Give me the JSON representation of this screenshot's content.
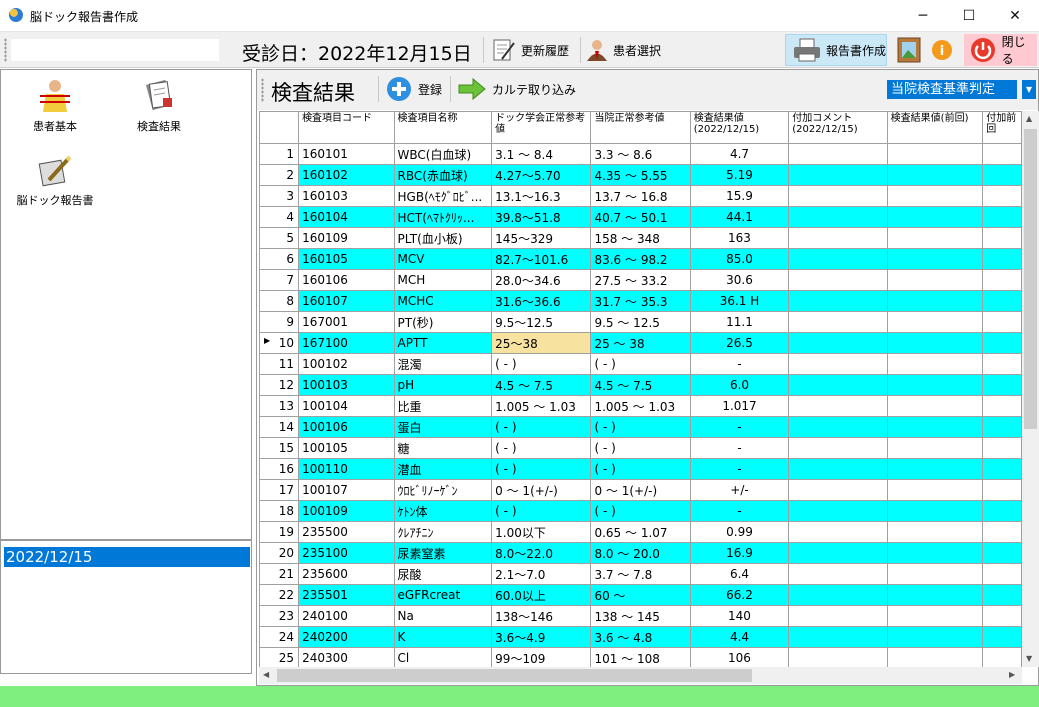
{
  "window": {
    "title": "脳ドック報告書作成",
    "minimize": "─",
    "maximize": "☐",
    "close": "✕"
  },
  "toolbar": {
    "visit_date": "受診日：2022年12月15日",
    "history_label": "更新履歴",
    "patient_select_label": "患者選択",
    "report_create_label": "報告書作成",
    "close_label": "閉じる"
  },
  "nav": {
    "patient_basic": "患者基本",
    "test_results": "検査結果",
    "brain_dock_report": "脳ドック報告書"
  },
  "dates": [
    "2022/12/15"
  ],
  "results": {
    "section_title": "検査結果",
    "register_label": "登録",
    "import_label": "カルテ取り込み",
    "judgement_select": "当院検査基準判定",
    "columns": [
      "検査項目コード",
      "検査項目名称",
      "ドック学会正常参考値",
      "当院正常参考値",
      "検査結果値(2022/12/15)",
      "付加コメント(2022/12/15)",
      "検査結果値(前回)",
      "付加前回"
    ],
    "selected_row": 10,
    "rows": [
      {
        "no": "1",
        "code": "160101",
        "name": "WBC(白血球)",
        "dock": "3.1 ～ 8.4",
        "hosp": "3.3 ～ 8.6",
        "value": "4.7"
      },
      {
        "no": "2",
        "code": "160102",
        "name": "RBC(赤血球)",
        "dock": "4.27～5.70",
        "hosp": "4.35 ～ 5.55",
        "value": "5.19"
      },
      {
        "no": "3",
        "code": "160103",
        "name": "HGB(ﾍﾓｸﾞﾛﾋﾞ...",
        "dock": "13.1～16.3",
        "hosp": "13.7 ～ 16.8",
        "value": "15.9"
      },
      {
        "no": "4",
        "code": "160104",
        "name": "HCT(ﾍﾏﾄｸﾘｯ...",
        "dock": "39.8～51.8",
        "hosp": "40.7 ～ 50.1",
        "value": "44.1"
      },
      {
        "no": "5",
        "code": "160109",
        "name": "PLT(血小板)",
        "dock": "145～329",
        "hosp": "158 ～ 348",
        "value": "163"
      },
      {
        "no": "6",
        "code": "160105",
        "name": "MCV",
        "dock": "82.7～101.6",
        "hosp": "83.6 ～ 98.2",
        "value": "85.0"
      },
      {
        "no": "7",
        "code": "160106",
        "name": "MCH",
        "dock": "28.0～34.6",
        "hosp": "27.5 ～ 33.2",
        "value": "30.6"
      },
      {
        "no": "8",
        "code": "160107",
        "name": "MCHC",
        "dock": "31.6～36.6",
        "hosp": "31.7 ～ 35.3",
        "value": "36.1  H"
      },
      {
        "no": "9",
        "code": "167001",
        "name": "PT(秒)",
        "dock": "9.5～12.5",
        "hosp": "9.5 ～ 12.5",
        "value": "11.1"
      },
      {
        "no": "10",
        "code": "167100",
        "name": "APTT",
        "dock": "25～38",
        "hosp": "25 ～ 38",
        "value": "26.5"
      },
      {
        "no": "11",
        "code": "100102",
        "name": "混濁",
        "dock": "( - )",
        "hosp": "( - )",
        "value": "-"
      },
      {
        "no": "12",
        "code": "100103",
        "name": "pH",
        "dock": "4.5 ～ 7.5",
        "hosp": "4.5 ～ 7.5",
        "value": "6.0"
      },
      {
        "no": "13",
        "code": "100104",
        "name": "比重",
        "dock": "1.005 ～ 1.03",
        "hosp": "1.005 ～ 1.03",
        "value": "1.017"
      },
      {
        "no": "14",
        "code": "100106",
        "name": "蛋白",
        "dock": "( - )",
        "hosp": "( - )",
        "value": "-"
      },
      {
        "no": "15",
        "code": "100105",
        "name": "糖",
        "dock": "( - )",
        "hosp": "( - )",
        "value": "-"
      },
      {
        "no": "16",
        "code": "100110",
        "name": "潜血",
        "dock": "( - )",
        "hosp": "( - )",
        "value": "-"
      },
      {
        "no": "17",
        "code": "100107",
        "name": "ｳﾛﾋﾞﾘﾉｰｹﾞﾝ",
        "dock": "0 ～ 1(+/-)",
        "hosp": "0 ～ 1(+/-)",
        "value": "+/-"
      },
      {
        "no": "18",
        "code": "100109",
        "name": "ｹﾄﾝ体",
        "dock": "( - )",
        "hosp": "( - )",
        "value": "-"
      },
      {
        "no": "19",
        "code": "235500",
        "name": "ｸﾚｱﾁﾆﾝ",
        "dock": "1.00以下",
        "hosp": "0.65 ～ 1.07",
        "value": "0.99"
      },
      {
        "no": "20",
        "code": "235100",
        "name": "尿素窒素",
        "dock": "8.0～22.0",
        "hosp": "8.0 ～ 20.0",
        "value": "16.9"
      },
      {
        "no": "21",
        "code": "235600",
        "name": "尿酸",
        "dock": "2.1～7.0",
        "hosp": "3.7 ～ 7.8",
        "value": "6.4"
      },
      {
        "no": "22",
        "code": "235501",
        "name": "eGFRcreat",
        "dock": "60.0以上",
        "hosp": "60 ～",
        "value": "66.2"
      },
      {
        "no": "23",
        "code": "240100",
        "name": "Na",
        "dock": "138～146",
        "hosp": "138 ～ 145",
        "value": "140"
      },
      {
        "no": "24",
        "code": "240200",
        "name": "K",
        "dock": "3.6～4.9",
        "hosp": "3.6 ～ 4.8",
        "value": "4.4"
      },
      {
        "no": "25",
        "code": "240300",
        "name": "Cl",
        "dock": "99～109",
        "hosp": "101 ～ 108",
        "value": "106"
      }
    ]
  },
  "colors": {
    "row_highlight": "#00ffff",
    "selected_cell": "#f7e29f",
    "status_bar": "#7ff07f",
    "selection_blue": "#0078d7"
  },
  "icons": [
    "app-globe-icon",
    "history-icon",
    "patient-icon",
    "printer-icon",
    "picture-icon",
    "info-icon",
    "power-icon",
    "patient-basic-icon",
    "test-results-icon",
    "report-icon",
    "register-plus-icon",
    "import-arrow-icon"
  ]
}
